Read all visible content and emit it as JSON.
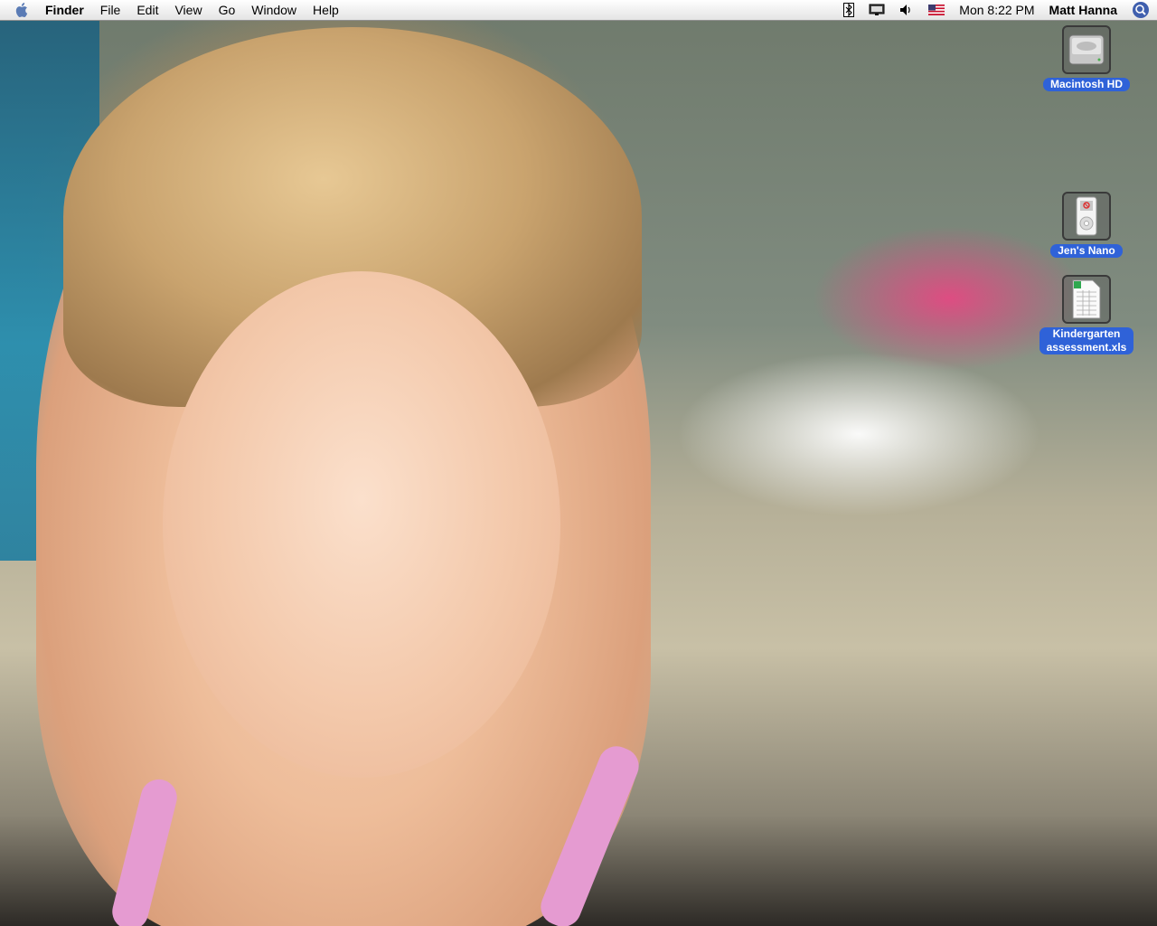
{
  "menubar": {
    "apple_icon": "apple-icon",
    "app_name": "Finder",
    "menus": [
      "File",
      "Edit",
      "View",
      "Go",
      "Window",
      "Help"
    ],
    "status_icons": [
      "bluetooth-icon",
      "display-icon",
      "volume-icon",
      "us-flag-icon"
    ],
    "clock": "Mon 8:22 PM",
    "username": "Matt Hanna",
    "spotlight_icon": "spotlight-icon"
  },
  "desktop": {
    "wallpaper": "photo of smiling toddler on patio cushion",
    "icons": [
      {
        "name": "Macintosh HD",
        "icon": "hard-drive-icon"
      },
      {
        "name": "Jen's Nano",
        "icon": "ipod-nano-icon"
      },
      {
        "name_line1": "Kindergarten",
        "name_line2": "assessment.xls",
        "icon": "spreadsheet-file-icon"
      }
    ]
  },
  "colors": {
    "selection_label": "#2f62d8",
    "menubar_bg": "#f1f1f1"
  }
}
